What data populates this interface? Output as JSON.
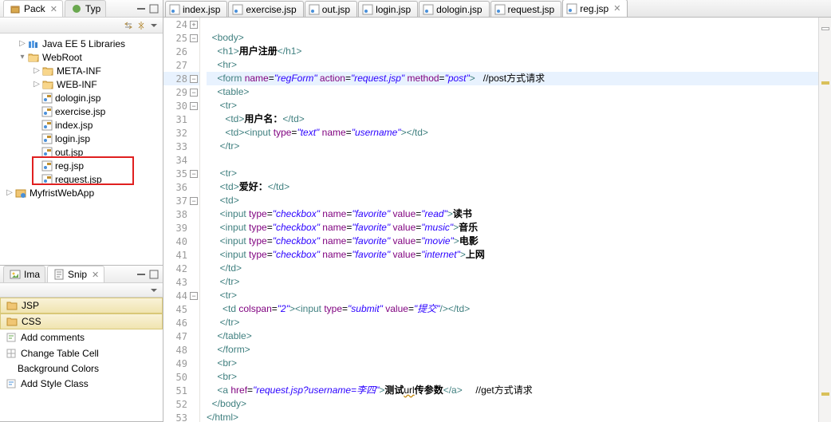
{
  "leftTabs": {
    "pack": "Pack",
    "typ": "Typ"
  },
  "toolbar": {
    "collapse": "⇔",
    "link": "⇵",
    "menu": "▾"
  },
  "tree": {
    "lib": "Java EE 5 Libraries",
    "webroot": "WebRoot",
    "meta": "META-INF",
    "web": "WEB-INF",
    "f1": "dologin.jsp",
    "f2": "exercise.jsp",
    "f3": "index.jsp",
    "f4": "login.jsp",
    "f5": "out.jsp",
    "f6": "reg.jsp",
    "f7": "request.jsp",
    "proj": "MyfristWebApp"
  },
  "bottomTabs": {
    "ima": "Ima",
    "snip": "Snip"
  },
  "snip": {
    "jsp": "JSP",
    "css": "CSS",
    "c1": "Add comments",
    "c2": "Change Table Cell",
    "c2b": "Background Colors",
    "c3": "Add Style Class"
  },
  "etabs": {
    "t1": "index.jsp",
    "t2": "exercise.jsp",
    "t3": "out.jsp",
    "t4": "login.jsp",
    "t5": "dologin.jsp",
    "t6": "request.jsp",
    "t7": "reg.jsp"
  },
  "ln": {
    "l24": "24",
    "l25": "25",
    "l26": "26",
    "l27": "27",
    "l28": "28",
    "l29": "29",
    "l30": "30",
    "l31": "31",
    "l32": "32",
    "l33": "33",
    "l34": "34",
    "l35": "35",
    "l36": "36",
    "l37": "37",
    "l38": "38",
    "l39": "39",
    "l40": "40",
    "l41": "41",
    "l42": "42",
    "l43": "43",
    "l44": "44",
    "l45": "45",
    "l46": "46",
    "l47": "47",
    "l48": "48",
    "l49": "49",
    "l50": "50",
    "l51": "51",
    "l52": "52",
    "l53": "53"
  },
  "code": {
    "c25a": "<body>",
    "c26a": "<h1>",
    "c26t": "用户注册",
    "c26b": "</h1>",
    "c27a": "<hr>",
    "c28a": "<form ",
    "c28n": "name",
    "c28nv": "\"regForm\"",
    "c28ac": " action",
    "c28av": "\"request.jsp\"",
    "c28m": " method",
    "c28mv": "\"post\"",
    "c28e": ">",
    "c28c": "   //post方式请求",
    "c29a": "<table>",
    "c30a": "<tr>",
    "c31a": "<td>",
    "c31t": "用户名：",
    "c31b": "</td>",
    "c32a": "<td><input ",
    "c32t": "type",
    "c32tv": "\"text\"",
    "c32n": " name",
    "c32nv": "\"username\"",
    "c32e": "></td>",
    "c33a": "</tr>",
    "c35a": "<tr>",
    "c36a": "<td>",
    "c36t": "爱好：",
    "c36b": "</td>",
    "c37a": "<td>",
    "c38a": "<input ",
    "c38t": "type",
    "c38tv": "\"checkbox\"",
    "c38n": " name",
    "c38nv": "\"favorite\"",
    "c38v": " value",
    "c38vv": "\"read\"",
    "c38e": ">",
    "c38txt": "读书",
    "c39a": "<input ",
    "c39t": "type",
    "c39tv": "\"checkbox\"",
    "c39n": " name",
    "c39nv": "\"favorite\"",
    "c39v": " value",
    "c39vv": "\"music\"",
    "c39e": ">",
    "c39txt": "音乐",
    "c40a": "<input ",
    "c40t": "type",
    "c40tv": "\"checkbox\"",
    "c40n": " name",
    "c40nv": "\"favorite\"",
    "c40v": " value",
    "c40vv": "\"movie\"",
    "c40e": ">",
    "c40txt": "电影",
    "c41a": "<input ",
    "c41t": "type",
    "c41tv": "\"checkbox\"",
    "c41n": " name",
    "c41nv": "\"favorite\"",
    "c41v": " value",
    "c41vv": "\"internet\"",
    "c41e": ">",
    "c41txt": "上网",
    "c42a": "</td>",
    "c43a": "</tr>",
    "c44a": "<tr>",
    "c45a": "<td ",
    "c45c": "colspan",
    "c45cv": "\"2\"",
    "c45b": "><input ",
    "c45t": "type",
    "c45tv": "\"submit\"",
    "c45v": " value",
    "c45vv": "\"提交\"",
    "c45e": "/></td>",
    "c46a": "</tr>",
    "c47a": "</table>",
    "c48a": "</form>",
    "c49a": "<br>",
    "c50a": "<br>",
    "c51a": "<a ",
    "c51h": "href",
    "c51hv": "\"request.jsp?username=李四\"",
    "c51b": ">",
    "c51t1": "测试",
    "c51u": "url",
    "c51t2": "传参数",
    "c51e": "</a>",
    "c51c": "     //get方式请求",
    "c52a": "</body>",
    "c53a": "</html>"
  }
}
